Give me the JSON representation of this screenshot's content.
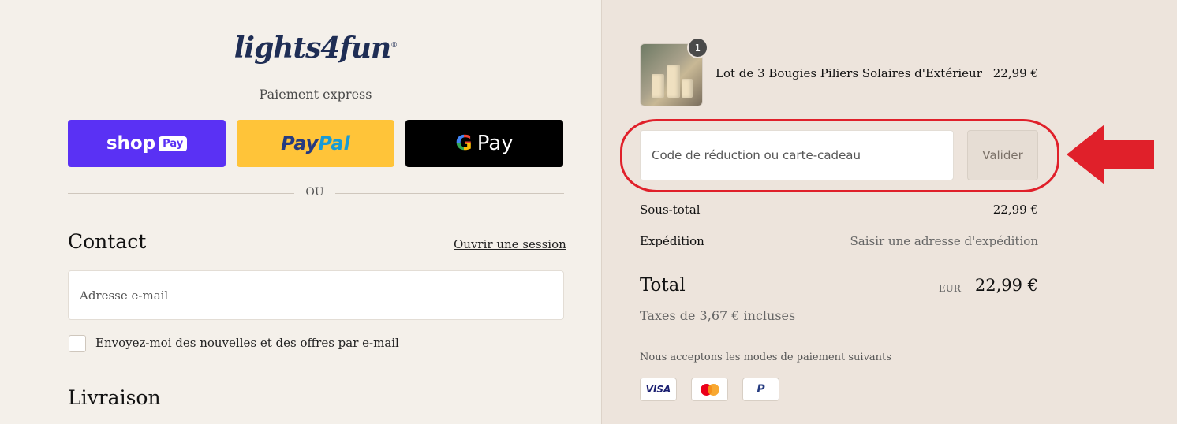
{
  "brand": {
    "logo_text": "lights4fun",
    "logo_mark": "®"
  },
  "express": {
    "heading": "Paiement express",
    "shop_pay": {
      "label": "shop",
      "badge": "Pay"
    },
    "paypal": {
      "part1": "Pay",
      "part2": "Pal"
    },
    "gpay": {
      "g": "G",
      "label": "Pay"
    },
    "separator": "OU"
  },
  "contact": {
    "title": "Contact",
    "login_link": "Ouvrir une session",
    "email_placeholder": "Adresse e-mail",
    "newsletter_label": "Envoyez-moi des nouvelles et des offres par e-mail"
  },
  "delivery": {
    "title": "Livraison"
  },
  "order": {
    "item": {
      "name": "Lot de 3 Bougies Piliers Solaires d'Extérieur",
      "price": "22,99 €",
      "quantity": "1"
    },
    "discount_placeholder": "Code de réduction ou carte-cadeau",
    "apply_label": "Valider",
    "subtotal_label": "Sous-total",
    "subtotal_value": "22,99 €",
    "shipping_label": "Expédition",
    "shipping_value": "Saisir une adresse d'expédition",
    "total_label": "Total",
    "currency": "EUR",
    "total_value": "22,99 €",
    "taxes": "Taxes de 3,67 € incluses",
    "accepted_heading": "Nous acceptons les modes de paiement suivants",
    "cards": {
      "visa": "VISA",
      "mastercard": "mastercard-icon",
      "paypal": "P"
    }
  },
  "colors": {
    "shop_pay": "#5a31f4",
    "paypal": "#ffc439",
    "gpay": "#000000",
    "annotation": "#e0202a"
  }
}
